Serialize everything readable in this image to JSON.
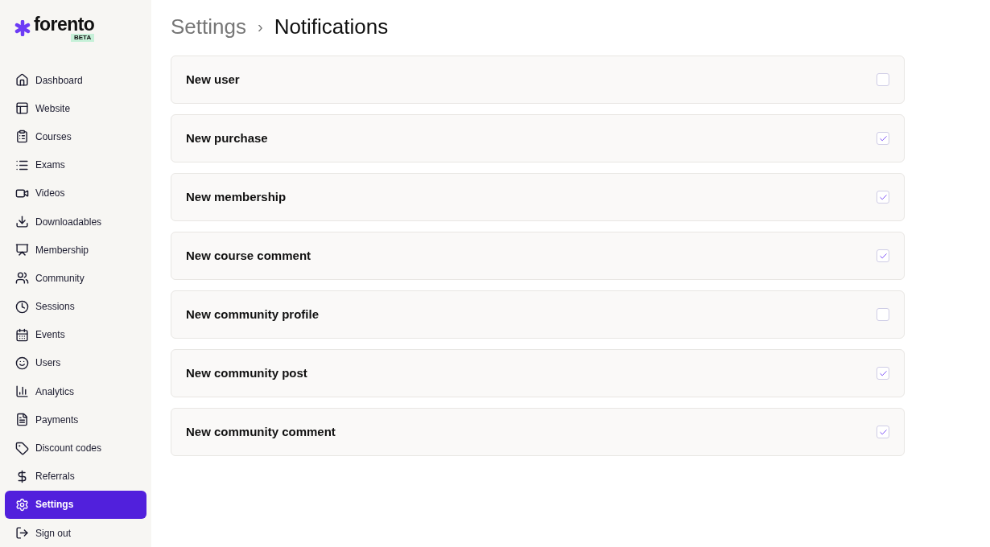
{
  "logo": {
    "name": "forento",
    "badge": "BETA"
  },
  "sidebar": {
    "items": [
      {
        "label": "Dashboard",
        "selected": false
      },
      {
        "label": "Website",
        "selected": false
      },
      {
        "label": "Courses",
        "selected": false
      },
      {
        "label": "Exams",
        "selected": false
      },
      {
        "label": "Videos",
        "selected": false
      },
      {
        "label": "Downloadables",
        "selected": false
      },
      {
        "label": "Membership",
        "selected": false
      },
      {
        "label": "Community",
        "selected": false
      },
      {
        "label": "Sessions",
        "selected": false
      },
      {
        "label": "Events",
        "selected": false
      },
      {
        "label": "Users",
        "selected": false
      },
      {
        "label": "Analytics",
        "selected": false
      },
      {
        "label": "Payments",
        "selected": false
      },
      {
        "label": "Discount codes",
        "selected": false
      },
      {
        "label": "Referrals",
        "selected": false
      },
      {
        "label": "Settings",
        "selected": true
      },
      {
        "label": "Sign out",
        "selected": false
      }
    ]
  },
  "breadcrumb": {
    "parent": "Settings",
    "separator": "›",
    "current": "Notifications"
  },
  "notifications": [
    {
      "label": "New user",
      "checked": false
    },
    {
      "label": "New purchase",
      "checked": true
    },
    {
      "label": "New membership",
      "checked": true
    },
    {
      "label": "New course comment",
      "checked": true
    },
    {
      "label": "New community profile",
      "checked": false
    },
    {
      "label": "New community post",
      "checked": true
    },
    {
      "label": "New community comment",
      "checked": true
    }
  ]
}
